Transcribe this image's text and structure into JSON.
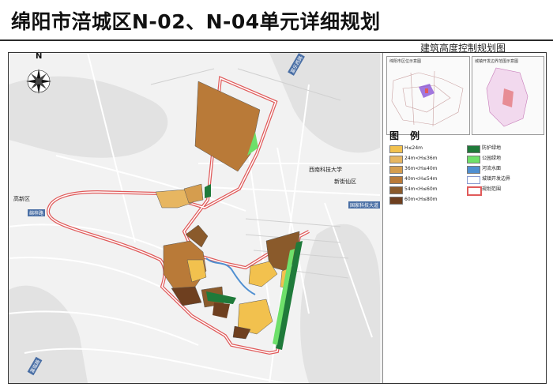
{
  "header": {
    "title": "绵阳市涪城区N-02、N-04单元详细规划",
    "subtitle": "建筑高度控制规划图"
  },
  "map": {
    "north_label": "N",
    "road_labels": [
      "富乐西路",
      "绵梓路",
      "国家科技大道",
      "富临路"
    ],
    "place_labels": [
      "西南科技大学",
      "新街仙区",
      "高新区"
    ],
    "colors": {
      "boundary": "#e05a5a",
      "road": "#ffffff",
      "terrain": "#e3e3e3",
      "road_label_bg": "#4a6fa5"
    }
  },
  "insets": [
    {
      "title": "绵阳市区位示意图"
    },
    {
      "title": "城镇开发边界范围示意图"
    }
  ],
  "legend": {
    "title": "图例",
    "items": [
      {
        "label": "H≤24m",
        "color": "#f2c14e"
      },
      {
        "label": "24m<H≤36m",
        "color": "#e7b661"
      },
      {
        "label": "36m<H≤40m",
        "color": "#d59d4e"
      },
      {
        "label": "40m<H≤54m",
        "color": "#b97a38"
      },
      {
        "label": "54m<H≤60m",
        "color": "#8a5a2b"
      },
      {
        "label": "60m<H≤80m",
        "color": "#6e3f1f"
      },
      {
        "label": "防护绿地",
        "color": "#1f7a3a"
      },
      {
        "label": "公园绿地",
        "color": "#6ee06a"
      },
      {
        "label": "河流水面",
        "color": "#4f8fd1"
      },
      {
        "label": "城镇开发边界",
        "color": "#ffffff"
      },
      {
        "label": "规划范围",
        "color": "#e05a5a"
      }
    ]
  }
}
